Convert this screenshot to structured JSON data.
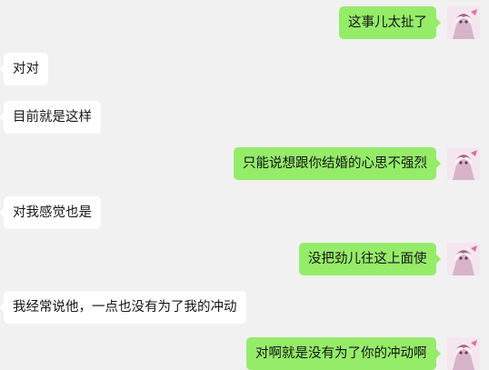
{
  "messages": [
    {
      "side": "out",
      "text": "这事儿太扯了"
    },
    {
      "side": "in",
      "text": "对对"
    },
    {
      "side": "in",
      "text": "目前就是这样"
    },
    {
      "side": "out",
      "text": "只能说想跟你结婚的心思不强烈"
    },
    {
      "side": "in",
      "text": "对我感觉也是"
    },
    {
      "side": "out",
      "text": "没把劲儿往这上面使"
    },
    {
      "side": "in",
      "text": "我经常说他，一点也没有为了我的冲动"
    },
    {
      "side": "out",
      "text": "对啊就是没有为了你的冲动啊"
    }
  ],
  "colors": {
    "background": "#f1f1f1",
    "outgoing_bubble": "#95ec69",
    "incoming_bubble": "#ffffff",
    "text": "#161616"
  },
  "icons": {
    "avatar": "anime-character-avatar-icon"
  }
}
